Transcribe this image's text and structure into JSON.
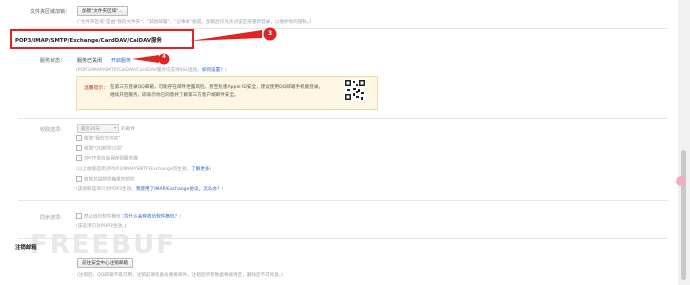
{
  "folder_sync": {
    "label": "文件夹区域加锁：",
    "button": "加锁\"文件夹区域\"...",
    "note": "(\"文件夹区域\"是由\"我的文件夹\"、\"其他邮箱\"、\"记事本\"组成。加锁后仅允许对该区域重新登录，以保护你的隐私。)"
  },
  "service_heading": "POP3/IMAP/SMTP/Exchange/CardDAV/CalDAV服务",
  "service": {
    "label": "服务状态：",
    "status": "服务已关闭",
    "enable_link": "开启服务",
    "note": "(POP3/IMAP/SMTP/CalDAV/CardDAV服务均支持SSL连接。",
    "how_link": "如何设置？",
    "note_end": ")"
  },
  "tip": {
    "title": "温馨提示：",
    "line1": "在第三方登录QQ邮箱，可能存在邮件泄露风险，甚至危害Apple ID安全，建议使用QQ邮箱手机版登录。",
    "line2": "继续开启服务，即表示你已同意并了解第三方客户端邮件安全。"
  },
  "receive": {
    "label": "收取选项：",
    "select_value": "最近30天",
    "select_suffix": "的邮件",
    "options": [
      "收取\"我的文件夹\"",
      "收取\"QQ邮件订阅\"",
      "SMTP发信后保存到服务器"
    ],
    "note1": "(以上收取选项对POP3/IMAP/SMTP/Exchange均生效。",
    "note1_link": "了解更多",
    "note1_end": ")",
    "option4": "收取垃圾邮件箱里的邮件",
    "note2": "(该收取选项只对POP3生效。",
    "note2_link": "我使用了IMAP/Exchange协议，怎么办？",
    "note2_end": ")"
  },
  "sync": {
    "label": "同步选项：",
    "option": "禁止收信软件删信",
    "link": "为什么会有收信软件删信？",
    "note": "(该选项只对POP3生效。)"
  },
  "deactivate": {
    "heading": "注销邮箱",
    "button": "前往安全中心注销邮箱",
    "note": "(注销后，QQ邮箱不再可用，注销前请先备份重要邮件，注销后所有数据将被清空，删除后不可恢复。)"
  },
  "annotations": {
    "step3": "3",
    "step4": "4"
  },
  "watermark": "FREEBUF",
  "colors": {
    "annotation_red": "#e02424",
    "link": "#2b63c5",
    "tip_bg": "#fdf6e3"
  }
}
